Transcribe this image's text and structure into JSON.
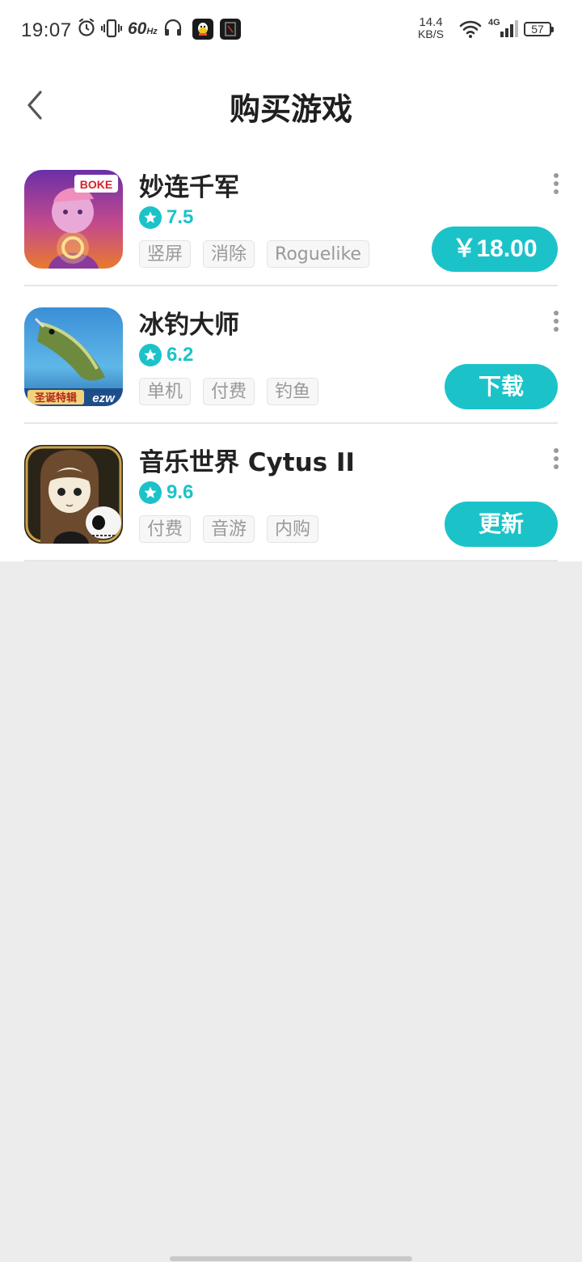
{
  "status_bar": {
    "time": "19:07",
    "refresh_rate": "60",
    "refresh_unit": "Hz",
    "net_speed_value": "14.4",
    "net_speed_unit": "KB/S",
    "network_type": "4G",
    "battery_level": "57",
    "icons": [
      "alarm-icon",
      "vibrate-icon",
      "headphones-icon",
      "qq-app-icon",
      "notification-app-icon",
      "wifi-icon",
      "signal-icon",
      "battery-icon"
    ]
  },
  "header": {
    "back_icon": "chevron-left-icon",
    "title": "购买游戏"
  },
  "colors": {
    "accent": "#1bc3c9",
    "background": "#ececec",
    "title_text": "#222222",
    "tag_text": "#999999"
  },
  "games": [
    {
      "name": "妙连千军",
      "rating": "7.5",
      "tags": [
        "竖屏",
        "消除",
        "Roguelike"
      ],
      "action": "￥18.00",
      "icon_badge": "BOKE"
    },
    {
      "name": "冰钓大师",
      "rating": "6.2",
      "tags": [
        "单机",
        "付费",
        "钓鱼"
      ],
      "action": "下载",
      "icon_badge": "圣诞特辑",
      "icon_badge2": "ezw"
    },
    {
      "name": "音乐世界 Cytus II",
      "rating": "9.6",
      "tags": [
        "付费",
        "音游",
        "内购"
      ],
      "action": "更新"
    }
  ]
}
